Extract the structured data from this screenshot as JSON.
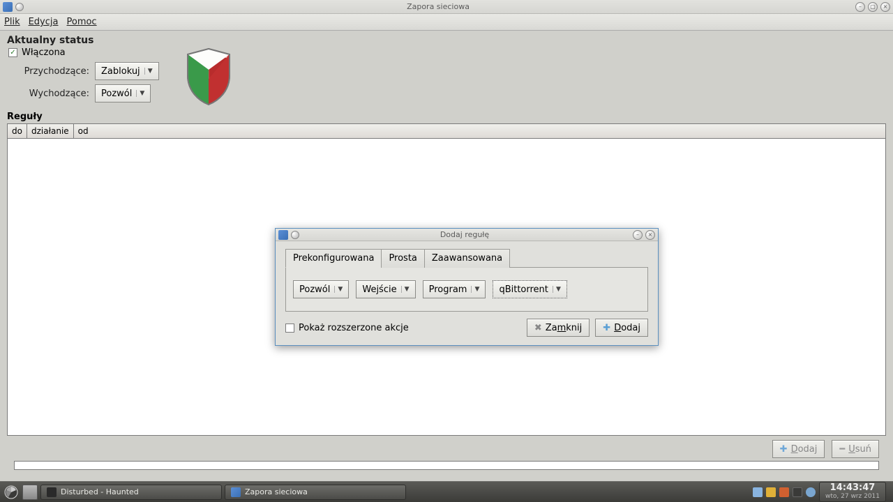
{
  "window": {
    "title": "Zapora sieciowa"
  },
  "menu": {
    "file": "Plik",
    "edit": "Edycja",
    "help": "Pomoc"
  },
  "status": {
    "heading": "Aktualny status",
    "enabled_label": "Włączona",
    "incoming_label": "Przychodzące:",
    "incoming_value": "Zablokuj",
    "outgoing_label": "Wychodzące:",
    "outgoing_value": "Pozwól"
  },
  "rules": {
    "heading": "Reguły",
    "columns": {
      "to": "do",
      "action": "działanie",
      "from": "od"
    }
  },
  "buttons": {
    "add": "Dodaj",
    "remove": "Usuń",
    "close": "Zamknij"
  },
  "dialog": {
    "title": "Dodaj regułę",
    "tabs": {
      "preconfigured": "Prekonfigurowana",
      "simple": "Prosta",
      "advanced": "Zaawansowana"
    },
    "fields": {
      "action": "Pozwól",
      "direction": "Wejście",
      "type": "Program",
      "program": "qBittorrent"
    },
    "show_extended": "Pokaż rozszerzone akcje"
  },
  "taskbar": {
    "task1": "Disturbed - Haunted",
    "task2": "Zapora sieciowa",
    "time": "14:43:47",
    "date": "wto, 27 wrz 2011"
  }
}
